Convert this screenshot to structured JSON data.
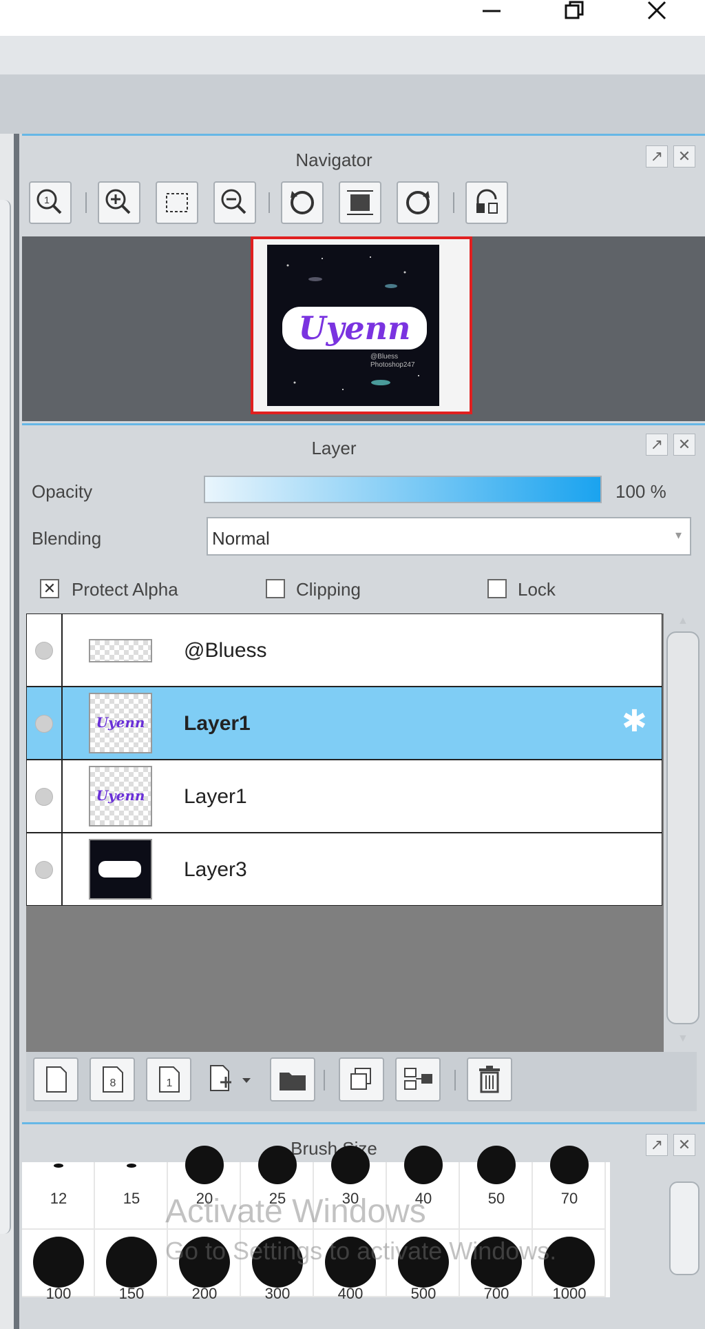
{
  "window": {
    "minimize_icon": "minimize-icon",
    "restore_icon": "restore-icon",
    "close_icon": "close-icon"
  },
  "navigator": {
    "title": "Navigator",
    "tools": [
      "zoom-actual-icon",
      "zoom-in-icon",
      "fit-icon",
      "zoom-out-icon",
      "rotate-left-icon",
      "rotate-reset-icon",
      "rotate-right-icon",
      "flip-icon"
    ],
    "preview": {
      "artwork_text": "Uyenn",
      "handle_line1": "@Bluess",
      "handle_line2": "Photoshop247",
      "frame_color": "#e02020"
    }
  },
  "layer": {
    "title": "Layer",
    "opacity_label": "Opacity",
    "opacity_value": "100 %",
    "opacity_fraction": 1.0,
    "blending_label": "Blending",
    "blending_value": "Normal",
    "protect_alpha_label": "Protect Alpha",
    "protect_alpha_checked": true,
    "clipping_label": "Clipping",
    "clipping_checked": false,
    "lock_label": "Lock",
    "lock_checked": false,
    "layers": [
      {
        "name": "@Bluess",
        "selected": false
      },
      {
        "name": "Layer1",
        "selected": true
      },
      {
        "name": "Layer1",
        "selected": false
      },
      {
        "name": "Layer3",
        "selected": false
      }
    ],
    "toolbar_icons": [
      "new-layer-icon",
      "new-8bit-layer-icon",
      "new-1bit-layer-icon",
      "add-layer-menu-icon",
      "new-folder-icon",
      "duplicate-layer-icon",
      "merge-down-icon",
      "delete-layer-icon"
    ],
    "selected_color": "#7fcdf5"
  },
  "brush_size": {
    "title": "Brush Size",
    "row1": [
      "12",
      "15",
      "20",
      "25",
      "30",
      "40",
      "50",
      "70"
    ],
    "row2": [
      "100",
      "150",
      "200",
      "300",
      "400",
      "500",
      "700",
      "1000"
    ]
  },
  "watermark": {
    "line1": "Activate Windows",
    "line2": "Go to Settings to activate Windows."
  }
}
